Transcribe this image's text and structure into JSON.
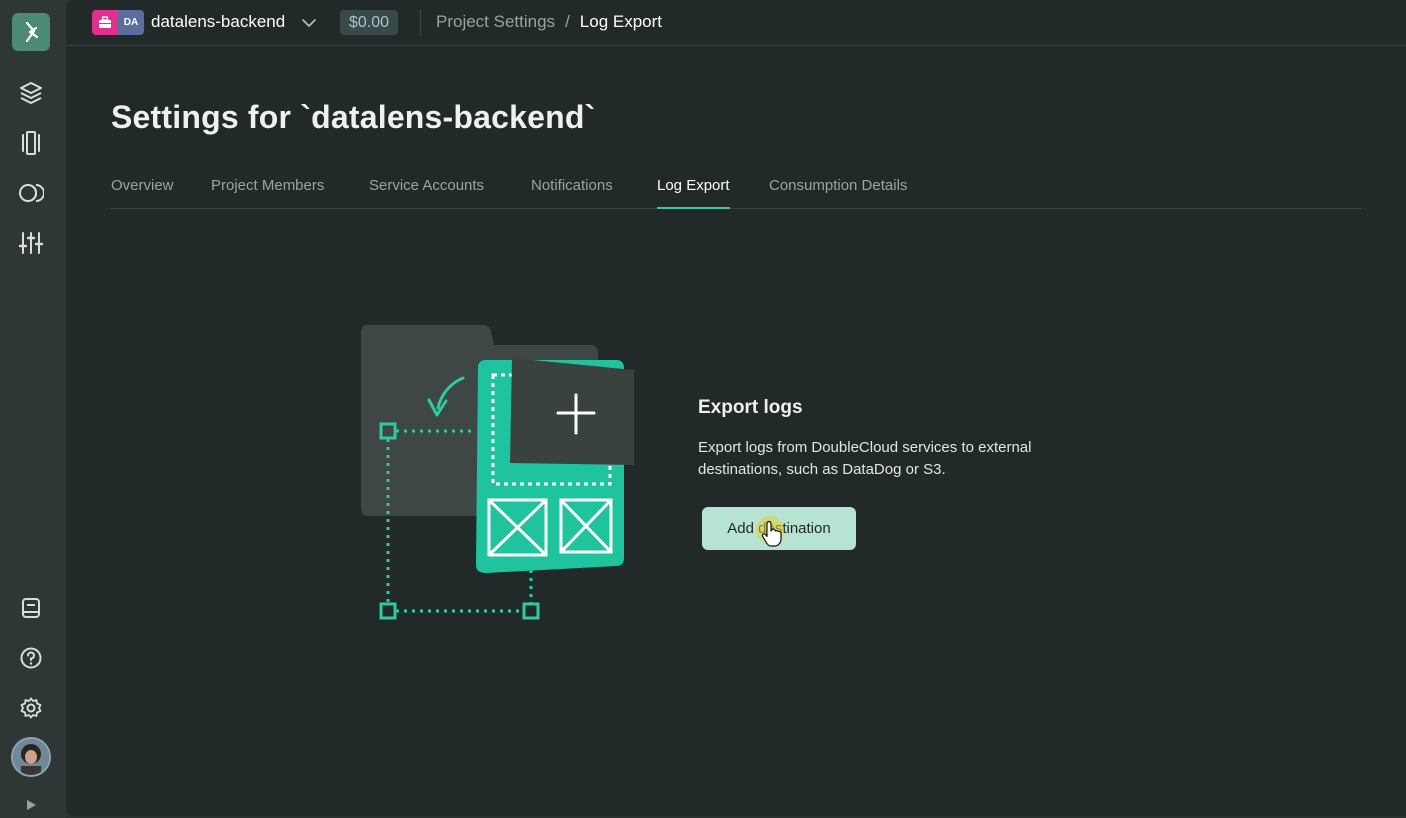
{
  "sidebar": {
    "nav_icons": [
      "logo-icon",
      "layers-icon",
      "cluster-icon",
      "transfer-icon",
      "sliders-icon"
    ],
    "bottom_icons": [
      "docs-icon",
      "help-icon",
      "settings-icon"
    ]
  },
  "topbar": {
    "project_badge": "DA",
    "project_name": "datalens-backend",
    "balance": "$0.00",
    "breadcrumb_parent": "Project Settings",
    "breadcrumb_separator": "/",
    "breadcrumb_current": "Log Export"
  },
  "page": {
    "title": "Settings for `datalens-backend`"
  },
  "tabs": [
    {
      "label": "Overview"
    },
    {
      "label": "Project Members"
    },
    {
      "label": "Service Accounts"
    },
    {
      "label": "Notifications"
    },
    {
      "label": "Log Export",
      "active": true
    },
    {
      "label": "Consumption Details"
    }
  ],
  "empty_state": {
    "title": "Export logs",
    "description": "Export logs from DoubleCloud services to external destinations, such as DataDog or S3.",
    "button_label": "Add destination"
  },
  "colors": {
    "accent": "#34c9a4",
    "button_bg": "#b7e3d2",
    "background": "#222a29"
  }
}
